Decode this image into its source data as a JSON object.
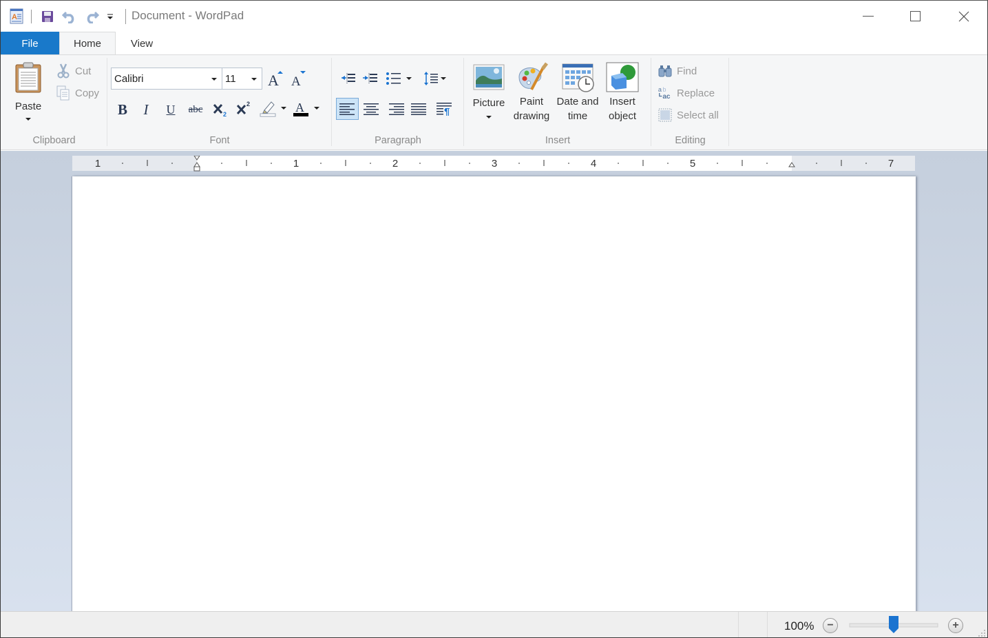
{
  "window": {
    "title": "Document - WordPad"
  },
  "titlebar": {
    "qat": [
      {
        "name": "app-icon"
      },
      {
        "name": "save-icon"
      },
      {
        "name": "undo-icon"
      },
      {
        "name": "redo-icon"
      },
      {
        "name": "customize-qat-icon"
      }
    ],
    "controls": [
      "minimize",
      "maximize",
      "close"
    ]
  },
  "tabs": [
    {
      "label": "File",
      "active": false
    },
    {
      "label": "Home",
      "active": true
    },
    {
      "label": "View",
      "active": false
    }
  ],
  "ribbon": {
    "clipboard": {
      "label": "Clipboard",
      "paste": "Paste",
      "cut": "Cut",
      "copy": "Copy"
    },
    "font": {
      "label": "Font",
      "family": "Calibri",
      "size": "11",
      "bold": "B",
      "italic": "I",
      "underline": "U",
      "strike": "abc",
      "grow": "A",
      "shrink": "A",
      "text_color": "#000000",
      "highlight_color": "#ffffff"
    },
    "paragraph": {
      "label": "Paragraph",
      "active_alignment": "left"
    },
    "insert": {
      "label": "Insert",
      "picture": "Picture",
      "paint_1": "Paint",
      "paint_2": "drawing",
      "datetime_1": "Date and",
      "datetime_2": "time",
      "object_1": "Insert",
      "object_2": "object"
    },
    "editing": {
      "label": "Editing",
      "find": "Find",
      "replace": "Replace",
      "select_all": "Select all"
    }
  },
  "ruler": {
    "labels": [
      "1",
      "1",
      "2",
      "3",
      "4",
      "5",
      "7"
    ],
    "unit": "inches"
  },
  "document": {
    "content": ""
  },
  "statusbar": {
    "zoom": "100%",
    "zoom_percent": 100,
    "slider_fraction": 0.5
  },
  "colors": {
    "file_tab": "#1979ca",
    "help": "#1a73d0",
    "slider_thumb": "#1a73d0",
    "active_button": "#cce4f7"
  }
}
